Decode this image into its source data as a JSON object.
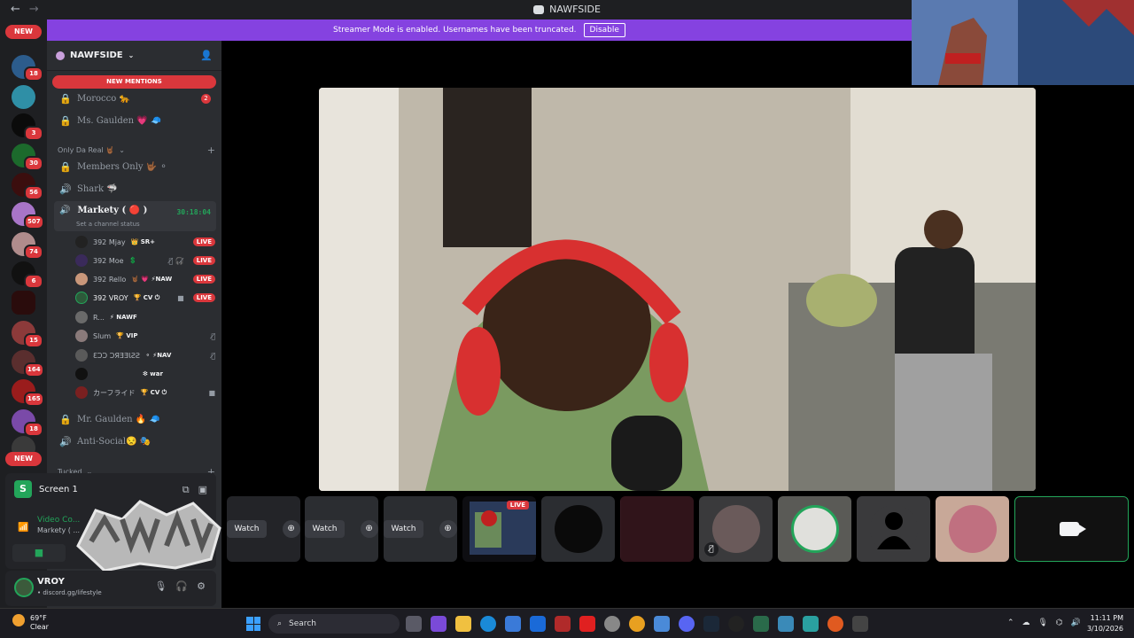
{
  "titlebar": {
    "title": "NAWFSIDE",
    "back": "←",
    "forward": "→"
  },
  "guilds": {
    "new_top": "NEW",
    "new_bottom": "NEW",
    "badges": [
      "18",
      "3",
      "30",
      "56",
      "507",
      "74",
      "6",
      "15",
      "164",
      "165",
      "18"
    ]
  },
  "banner": {
    "text": "Streamer Mode is enabled. Usernames have been truncated.",
    "button": "Disable"
  },
  "sidebar": {
    "server_name": "NAWFSIDE",
    "new_mentions": "NEW MENTIONS",
    "channels_top": [
      {
        "name": "Morocco 🐆",
        "badge": "2"
      },
      {
        "name": "Ms. Gaulden 💗 🧢",
        "badge": ""
      }
    ],
    "category1": "Only Da Real 🤘🏾",
    "channels_mid": [
      {
        "name": "Members Only 🤟🏾 ⚬"
      },
      {
        "name": "Shark 🦈"
      }
    ],
    "active_channel": {
      "name": "Markety ( 🔴 )",
      "time": "30:18:04",
      "status": "Set a channel status"
    },
    "users": [
      {
        "name": "392 Mjay",
        "tag": "👑 SR+",
        "live": "LIVE"
      },
      {
        "name": "392 Moe",
        "tag": "💲",
        "live": "LIVE"
      },
      {
        "name": "392 Rello",
        "tag": "🤘🏾 💗  ⚡NAW",
        "live": "LIVE"
      },
      {
        "name": "392 VROY",
        "tag": "🏆 CV ⏻",
        "live": "LIVE"
      },
      {
        "name": "R...",
        "tag": "⚡ NAWF",
        "live": ""
      },
      {
        "name": "Slum",
        "tag": "🏆 VIP",
        "live": ""
      },
      {
        "name": "ƐƆƆ ƆЯƎƎƖƧƧ",
        "tag": "⚬ ⚡NAV",
        "live": ""
      },
      {
        "name": "",
        "tag": "❇ war",
        "live": ""
      },
      {
        "name": "カーフライド",
        "tag": "🏆 CV ⏻",
        "live": ""
      }
    ],
    "channels_bottom": [
      {
        "name": "Mr. Gaulden 🔥 🧢"
      },
      {
        "name": "Anti-Social😒 🎭"
      }
    ],
    "category2": "Tucked"
  },
  "rtc": {
    "screen_label": "Screen 1",
    "conn_title": "Video Co...",
    "conn_channel": "Markety ( ..."
  },
  "userbar": {
    "name": "VROY",
    "status": "• discord.gg/lifestyle"
  },
  "tiles": {
    "watch_label": "Watch",
    "live_label": "LIVE"
  },
  "taskbar": {
    "temp": "69°F",
    "condition": "Clear",
    "weather_badge": "3",
    "search": "Search",
    "time": "11:11 PM",
    "date": "3/10/2026"
  },
  "colors": {
    "accent": "#8542e0",
    "live": "#da373c",
    "online": "#23a55a"
  }
}
